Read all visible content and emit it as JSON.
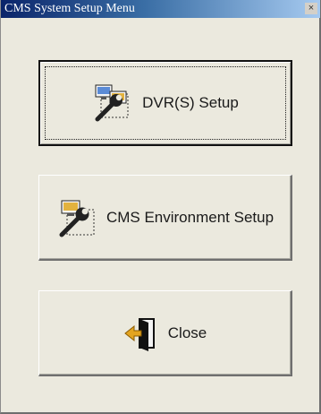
{
  "window": {
    "title": "CMS System Setup Menu",
    "close_glyph": "×"
  },
  "buttons": {
    "dvr_setup": {
      "label": "DVR(S) Setup",
      "icon": "monitor-wrench-icon"
    },
    "cms_environment_setup": {
      "label": "CMS Environment Setup",
      "icon": "monitor-wrench-icon"
    },
    "close": {
      "label": "Close",
      "icon": "exit-door-icon"
    }
  },
  "colors": {
    "title_start": "#0a246a",
    "title_end": "#a6caf0",
    "face": "#ebe9de"
  }
}
